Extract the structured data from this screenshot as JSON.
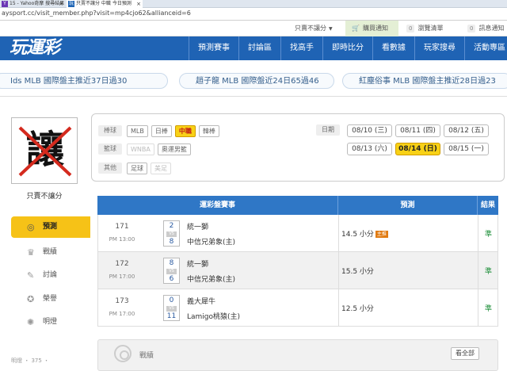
{
  "browser": {
    "tabs": [
      {
        "title": "15 - Yahoo奇摩 搜尋結果",
        "icon": "Y"
      },
      {
        "title": "只賣不讓分 中職 今日預測",
        "icon": "玩"
      }
    ],
    "address": "aysport.cc/visit_member.php?visit=mp4cjo62&allianceid=6"
  },
  "toplinks": {
    "dropdown": "只賣不讓分",
    "cart": "購買通知",
    "browse_count": "0",
    "browse_label": "瀏覽清單",
    "msg_count": "0",
    "msg_label": "訊息通知"
  },
  "header": {
    "logo": "玩運彩",
    "nav": [
      "預測賽事",
      "討論區",
      "找高手",
      "即時比分",
      "看數據",
      "玩家搜尋",
      "活動專區"
    ]
  },
  "ticker": [
    "Ids MLB 國際盤主推近37日過30",
    "趙子龍 MLB 國際盤近24日65過46",
    "紅塵俗事 MLB 國際盤主推近28日過23"
  ],
  "user": {
    "avatar_char": "讓",
    "name": "只賣不讓分"
  },
  "sidebar": [
    {
      "label": "預測",
      "active": true,
      "icon": "target-icon"
    },
    {
      "label": "戰績",
      "active": false,
      "icon": "trophy-icon"
    },
    {
      "label": "討論",
      "active": false,
      "icon": "pencil-icon"
    },
    {
      "label": "榮譽",
      "active": false,
      "icon": "medal-icon"
    },
    {
      "label": "明燈",
      "active": false,
      "icon": "lamp-icon"
    }
  ],
  "bottom_left": "明燈 ・ 375 ・",
  "filters": {
    "rows": [
      {
        "category": "棒球",
        "options": [
          {
            "label": "MLB",
            "state": "normal"
          },
          {
            "label": "日棒",
            "state": "normal"
          },
          {
            "label": "中職",
            "state": "active"
          },
          {
            "label": "韓棒",
            "state": "normal"
          }
        ]
      },
      {
        "category": "籃球",
        "options": [
          {
            "label": "WNBA",
            "state": "disabled"
          },
          {
            "label": "奧運男籃",
            "state": "normal"
          }
        ]
      },
      {
        "category": "其他",
        "options": [
          {
            "label": "足球",
            "state": "normal"
          },
          {
            "label": "美足",
            "state": "disabled"
          }
        ]
      }
    ],
    "date_label": "日期",
    "dates_row1": [
      {
        "label": "08/10 (三)",
        "active": false
      },
      {
        "label": "08/11 (四)",
        "active": false
      },
      {
        "label": "08/12 (五)",
        "active": false
      }
    ],
    "dates_row2": [
      {
        "label": "08/13 (六)",
        "active": false
      },
      {
        "label": "08/14 (日)",
        "active": true
      },
      {
        "label": "08/15 (一)",
        "active": false
      }
    ]
  },
  "table": {
    "headers": [
      "運彩盤賽事",
      "預測",
      "結果"
    ],
    "rows": [
      {
        "no": "171",
        "time": "PM 13:00",
        "score1": "2",
        "vs": "VS",
        "score2": "8",
        "team1": "統一獅",
        "team2": "中信兄弟象(主)",
        "prediction": "14.5 小分",
        "badge": "主推",
        "result": "準"
      },
      {
        "no": "172",
        "time": "PM 17:00",
        "score1": "8",
        "vs": "VS",
        "score2": "6",
        "team1": "統一獅",
        "team2": "中信兄弟象(主)",
        "prediction": "15.5 小分",
        "badge": "",
        "result": "準"
      },
      {
        "no": "173",
        "time": "PM 17:00",
        "score1": "0",
        "vs": "VS",
        "score2": "11",
        "team1": "義大犀牛",
        "team2": "Lamigo桃猿(主)",
        "prediction": "12.5 小分",
        "badge": "",
        "result": "準"
      }
    ]
  },
  "records": {
    "title": "戰績",
    "button": "看全部"
  }
}
